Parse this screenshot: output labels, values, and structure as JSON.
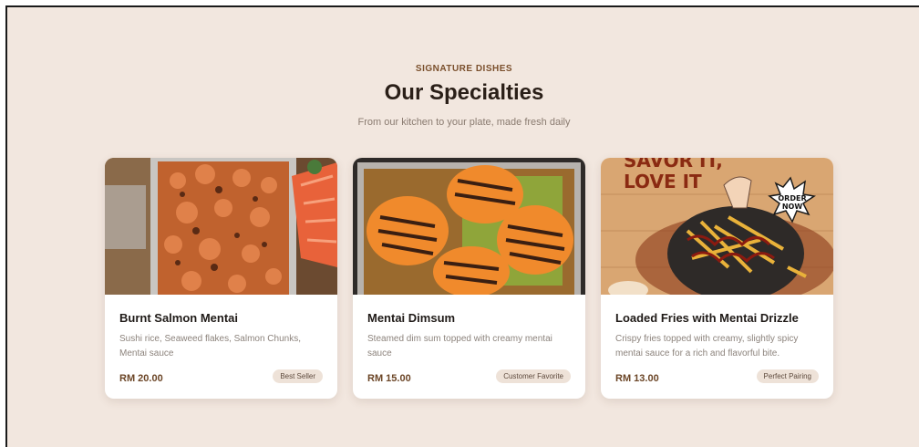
{
  "section": {
    "eyebrow": "SIGNATURE DISHES",
    "title": "Our Specialties",
    "subtitle": "From our kitchen to your plate, made fresh daily"
  },
  "dishes": [
    {
      "name": "Burnt Salmon Mentai",
      "description": "Sushi rice, Seaweed flakes, Salmon Chunks, Mentai sauce",
      "price": "RM 20.00",
      "badge": "Best Seller"
    },
    {
      "name": "Mentai Dimsum",
      "description": "Steamed dim sum topped with creamy mentai sauce",
      "price": "RM 15.00",
      "badge": "Customer Favorite"
    },
    {
      "name": "Loaded Fries with Mentai Drizzle",
      "description": "Crispy fries topped with creamy, slightly spicy mentai sauce for a rich and flavorful bite.",
      "price": "RM 13.00",
      "badge": "Perfect Pairing",
      "poster_text": {
        "headline_line1": "SAVOR IT,",
        "headline_line2": "LOVE IT",
        "burst_line1": "ORDER",
        "burst_line2": "NOW"
      }
    }
  ],
  "colors": {
    "background": "#f2e7df",
    "accent": "#7a4f2c",
    "badge_bg": "#eee2d8"
  }
}
